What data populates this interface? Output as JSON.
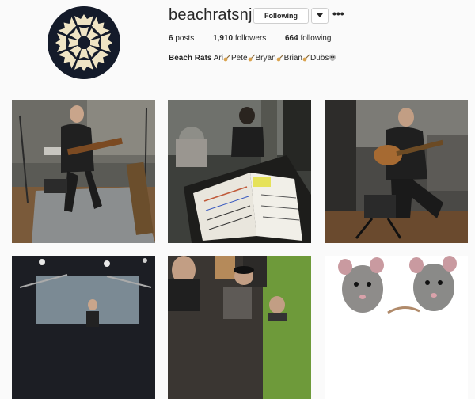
{
  "profile": {
    "username": "beachratsnj",
    "following_label": "Following",
    "more_label": "•••",
    "stats": {
      "posts_count": "6",
      "posts_label": "posts",
      "followers_count": "1,910",
      "followers_label": "followers",
      "following_count": "664",
      "following_label": "following"
    },
    "bio": {
      "name": "Beach Rats",
      "members": [
        "Ari",
        "Pete",
        "Bryan",
        "Brian",
        "Dubs"
      ]
    }
  },
  "icons": {
    "avatar": "star-burst-logo",
    "dropdown": "chevron-down-icon",
    "more": "ellipsis-icon",
    "member_emoji": "guitar-icon",
    "last_emoji": "skull-icon"
  },
  "colors": {
    "background": "#fafafa",
    "text": "#262626",
    "border": "#cfcfcf",
    "avatar_bg": "#141b2a",
    "avatar_pattern": "#efe4c4"
  }
}
